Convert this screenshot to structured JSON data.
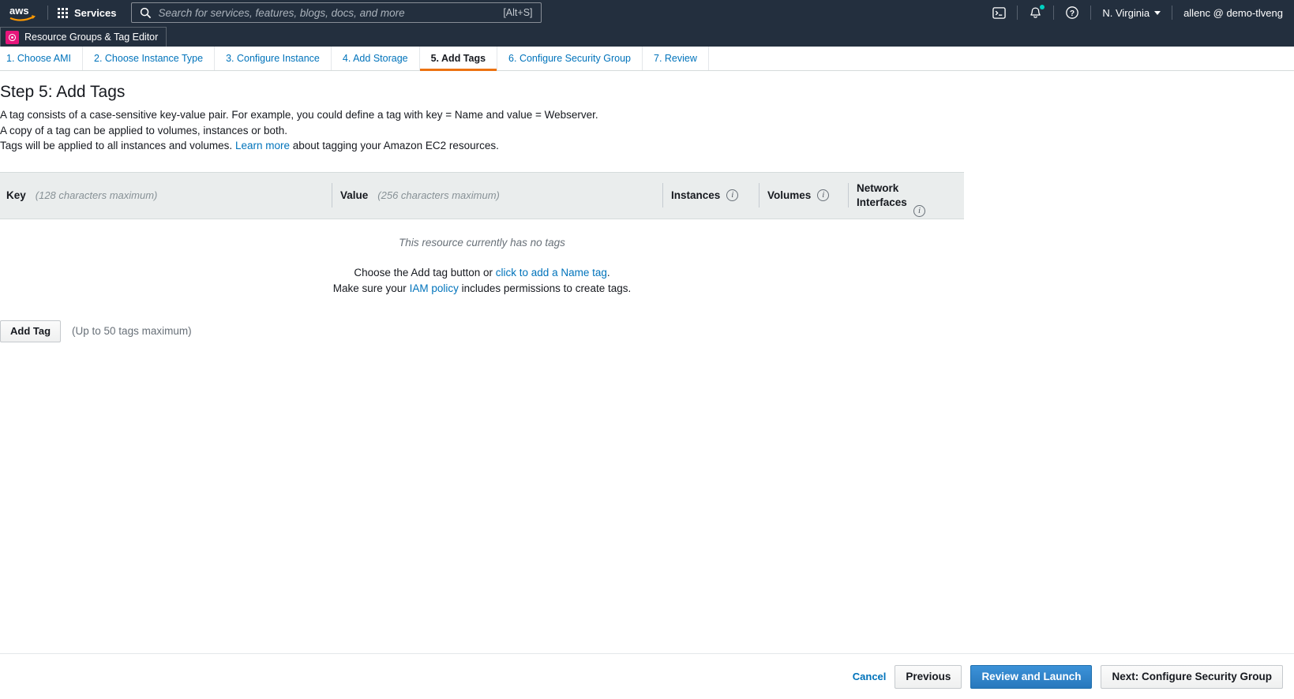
{
  "topnav": {
    "logo_icon": "aws-logo",
    "services_label": "Services",
    "services_icon": "grid-icon",
    "search": {
      "icon": "search-icon",
      "placeholder": "Search for services, features, blogs, docs, and more",
      "value": "",
      "shortcut": "[Alt+S]"
    },
    "cloudshell_icon": "terminal-icon",
    "notifications_icon": "bell-icon",
    "notifications_badge_color": "#00d1c1",
    "help_icon": "question-circle-icon",
    "region_label": "N. Virginia",
    "region_caret_icon": "chevron-down-icon",
    "account_label": "allenc @ demo-tlveng"
  },
  "service_tab": {
    "label": "Resource Groups & Tag Editor",
    "icon": "resource-groups-icon",
    "icon_color": "#e7157b"
  },
  "wizard": {
    "active_index": 4,
    "active_underline_color": "#ec7211",
    "steps": [
      {
        "label": "1. Choose AMI"
      },
      {
        "label": "2. Choose Instance Type"
      },
      {
        "label": "3. Configure Instance"
      },
      {
        "label": "4. Add Storage"
      },
      {
        "label": "5. Add Tags"
      },
      {
        "label": "6. Configure Security Group"
      },
      {
        "label": "7. Review"
      }
    ]
  },
  "main": {
    "title": "Step 5: Add Tags",
    "desc_line1": "A tag consists of a case-sensitive key-value pair. For example, you could define a tag with key = Name and value = Webserver.",
    "desc_line2": "A copy of a tag can be applied to volumes, instances or both.",
    "desc_line3_pre": "Tags will be applied to all instances and volumes.",
    "desc_line3_link": "Learn more",
    "desc_line3_post": "about tagging your Amazon EC2 resources.",
    "table": {
      "columns": [
        {
          "label": "Key",
          "hint": "(128 characters maximum)",
          "info": false
        },
        {
          "label": "Value",
          "hint": "(256 characters maximum)",
          "info": false
        },
        {
          "label": "Instances",
          "hint": "",
          "info": true
        },
        {
          "label": "Volumes",
          "hint": "",
          "info": true
        },
        {
          "label": "Network Interfaces",
          "hint": "",
          "info": true
        }
      ],
      "info_icon": "info-icon",
      "empty_message": "This resource currently has no tags",
      "hint_line1_pre": "Choose the Add tag button or",
      "hint_line1_link": "click to add a Name tag",
      "hint_line1_post": ".",
      "hint_line2_pre": "Make sure your",
      "hint_line2_link": "IAM policy",
      "hint_line2_post": "includes permissions to create tags.",
      "rows": []
    },
    "add_tag_label": "Add Tag",
    "max_tags_hint": "(Up to 50 tags maximum)"
  },
  "footer": {
    "cancel_label": "Cancel",
    "previous_label": "Previous",
    "review_label": "Review and Launch",
    "next_label": "Next: Configure Security Group",
    "primary_color": "#2878bd"
  }
}
